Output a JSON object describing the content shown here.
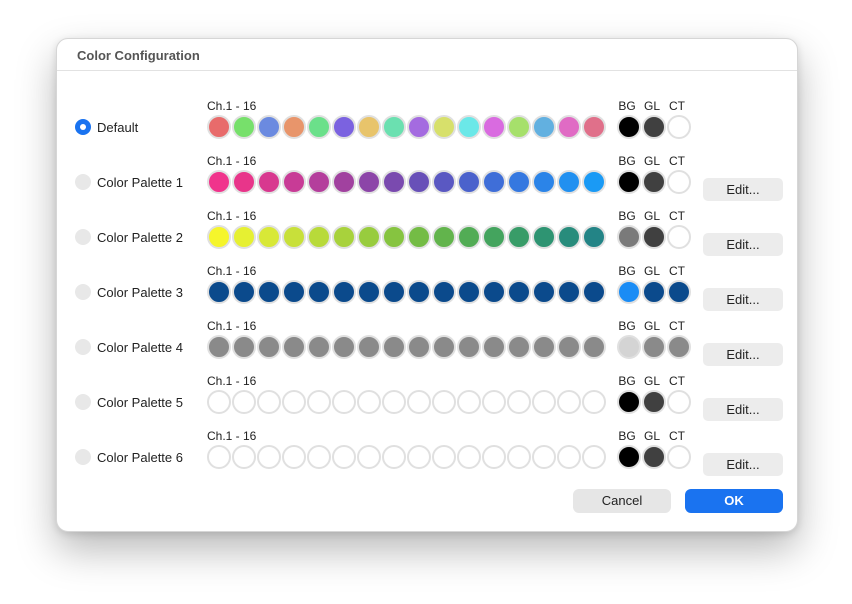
{
  "dialog": {
    "title": "Color Configuration",
    "cancel_label": "Cancel",
    "ok_label": "OK",
    "channel_label": "Ch.1 - 16",
    "extra_labels": [
      "BG",
      "GL",
      "CT"
    ],
    "edit_label": "Edit..."
  },
  "palettes": [
    {
      "name": "Default",
      "selected": true,
      "editable": false,
      "channels": [
        "#e86b6b",
        "#77e06b",
        "#6b8ae0",
        "#e8956b",
        "#6be08a",
        "#7b62e0",
        "#e8c46b",
        "#6be0b0",
        "#a46be0",
        "#d7e06b",
        "#6be8e8",
        "#d96be0",
        "#a6e06b",
        "#62b0e0",
        "#e06bc4",
        "#e0708a"
      ],
      "extras": [
        "#000000",
        "#404040",
        "#ffffff"
      ]
    },
    {
      "name": "Color Palette 1",
      "selected": false,
      "editable": true,
      "channels": [
        "#f0348c",
        "#e8358a",
        "#d8388f",
        "#c83b96",
        "#b43e9c",
        "#a1419f",
        "#8c45a8",
        "#7a4aaf",
        "#6850b8",
        "#5a58c2",
        "#4b62cc",
        "#3f6ed8",
        "#3578e0",
        "#2b84e8",
        "#2190f0",
        "#1a9af5"
      ],
      "extras": [
        "#000000",
        "#404040",
        "#ffffff"
      ]
    },
    {
      "name": "Color Palette 2",
      "selected": false,
      "editable": true,
      "channels": [
        "#f5f52b",
        "#e6f032",
        "#d8e837",
        "#c8e03a",
        "#b8da3a",
        "#a8d23c",
        "#98cc3e",
        "#86c440",
        "#74bc45",
        "#62b44c",
        "#52ac55",
        "#44a45e",
        "#389c68",
        "#2e9472",
        "#288c7c",
        "#238486"
      ],
      "extras": [
        "#7a7a7a",
        "#404040",
        "#ffffff"
      ]
    },
    {
      "name": "Color Palette 3",
      "selected": false,
      "editable": true,
      "channels": [
        "#0b4a8c",
        "#0b4a8c",
        "#0b4a8c",
        "#0b4a8c",
        "#0b4a8c",
        "#0b4a8c",
        "#0b4a8c",
        "#0b4a8c",
        "#0b4a8c",
        "#0b4a8c",
        "#0b4a8c",
        "#0b4a8c",
        "#0b4a8c",
        "#0b4a8c",
        "#0b4a8c",
        "#0b4a8c"
      ],
      "extras": [
        "#1a8cf5",
        "#0b4a8c",
        "#0b4a8c"
      ]
    },
    {
      "name": "Color Palette 4",
      "selected": false,
      "editable": true,
      "channels": [
        "#8a8a8a",
        "#8a8a8a",
        "#8a8a8a",
        "#8a8a8a",
        "#8a8a8a",
        "#8a8a8a",
        "#8a8a8a",
        "#8a8a8a",
        "#8a8a8a",
        "#8a8a8a",
        "#8a8a8a",
        "#8a8a8a",
        "#8a8a8a",
        "#8a8a8a",
        "#8a8a8a",
        "#8a8a8a"
      ],
      "extras": [
        "#d4d4d4",
        "#8a8a8a",
        "#8a8a8a"
      ]
    },
    {
      "name": "Color Palette 5",
      "selected": false,
      "editable": true,
      "channels": [
        "#ffffff",
        "#ffffff",
        "#ffffff",
        "#ffffff",
        "#ffffff",
        "#ffffff",
        "#ffffff",
        "#ffffff",
        "#ffffff",
        "#ffffff",
        "#ffffff",
        "#ffffff",
        "#ffffff",
        "#ffffff",
        "#ffffff",
        "#ffffff"
      ],
      "extras": [
        "#000000",
        "#404040",
        "#ffffff"
      ]
    },
    {
      "name": "Color Palette 6",
      "selected": false,
      "editable": true,
      "channels": [
        "#ffffff",
        "#ffffff",
        "#ffffff",
        "#ffffff",
        "#ffffff",
        "#ffffff",
        "#ffffff",
        "#ffffff",
        "#ffffff",
        "#ffffff",
        "#ffffff",
        "#ffffff",
        "#ffffff",
        "#ffffff",
        "#ffffff",
        "#ffffff"
      ],
      "extras": [
        "#000000",
        "#404040",
        "#ffffff"
      ]
    }
  ]
}
